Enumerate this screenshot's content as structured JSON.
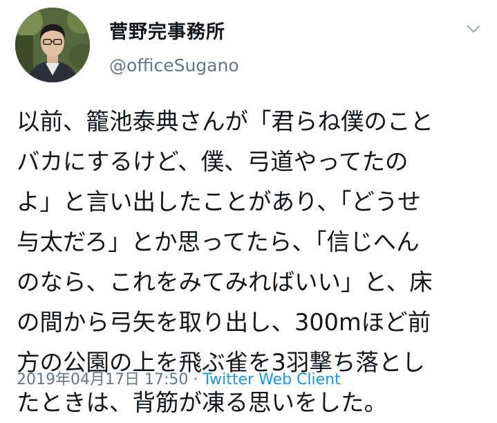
{
  "tweet": {
    "display_name": "菅野完事務所",
    "handle": "@officeSugano",
    "avatar_icon": "user-avatar-photo",
    "menu_icon": "chevron-down-icon",
    "text_lines": [
      "以前、籠池泰典さんが「君らね僕のこと",
      "バカにするけど、僕、弓道やってたの",
      "よ」と言い出したことがあり、「どうせ",
      "与太だろ」とか思ってたら、「信じへん",
      "のなら、これをみてみればいい」と、床",
      "の間から弓矢を取り出し、300mほど前",
      "方の公園の上を飛ぶ雀を3羽撃ち落とし",
      "たときは、背筋が凍る思いをした。"
    ],
    "timestamp": "2019年04月17日 17:50",
    "separator": " · ",
    "source": "Twitter Web Client"
  },
  "colors": {
    "text": "#14171a",
    "secondary": "#657786",
    "link": "#1b95e0"
  }
}
